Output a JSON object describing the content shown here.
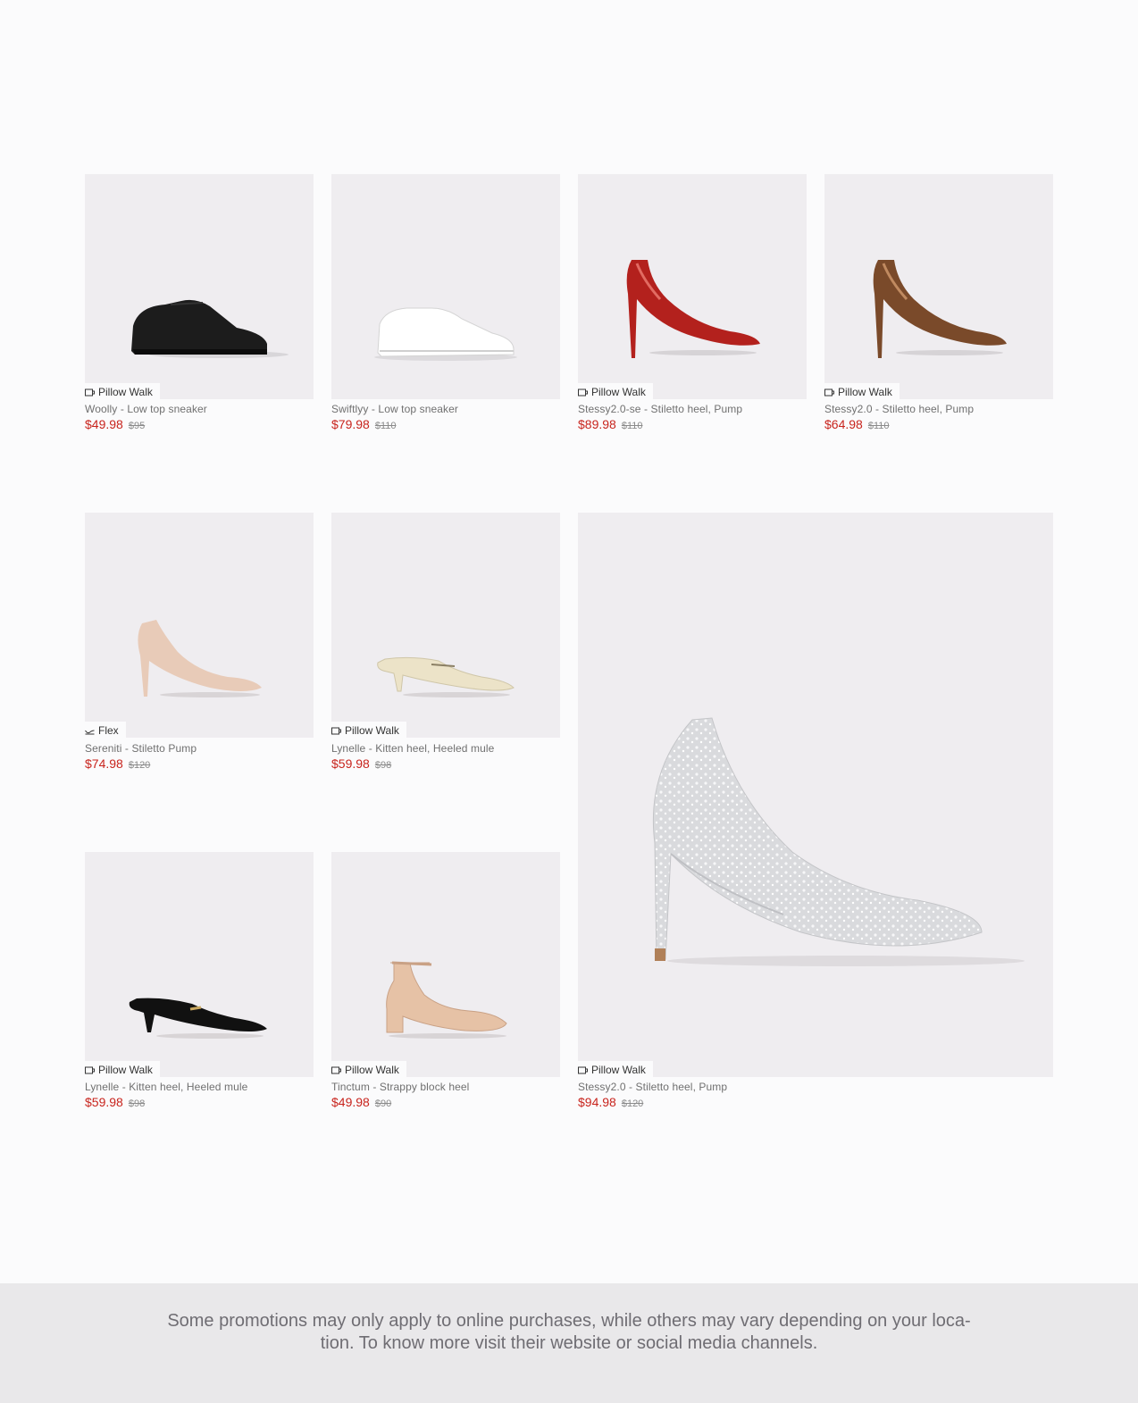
{
  "products": [
    {
      "badge": "Pillow Walk",
      "badge_icon": "cushion-icon",
      "name": "Woolly - Low top sneaker",
      "sale_price": "$49.98",
      "original_price": "$95",
      "shoe": "black-sneaker",
      "color": "#1a1a1a"
    },
    {
      "badge": "",
      "badge_icon": "",
      "name": "Swiftlyy - Low top sneaker",
      "sale_price": "$79.98",
      "original_price": "$110",
      "shoe": "white-sneaker",
      "color": "#ffffff"
    },
    {
      "badge": "Pillow Walk",
      "badge_icon": "cushion-icon",
      "name": "Stessy2.0-se - Stiletto heel, Pump",
      "sale_price": "$89.98",
      "original_price": "$110",
      "shoe": "red-metallic-pump",
      "color": "#b3211d"
    },
    {
      "badge": "Pillow Walk",
      "badge_icon": "cushion-icon",
      "name": "Stessy2.0 - Stiletto heel, Pump",
      "sale_price": "$64.98",
      "original_price": "$110",
      "shoe": "bronze-metallic-pump",
      "color": "#7a4a2a"
    },
    {
      "badge": "Flex",
      "badge_icon": "flex-icon",
      "name": "Sereniti - Stiletto Pump",
      "sale_price": "$74.98",
      "original_price": "$120",
      "shoe": "nude-pump",
      "color": "#e8cbb8"
    },
    {
      "badge": "Pillow Walk",
      "badge_icon": "cushion-icon",
      "name": "Lynelle - Kitten heel, Heeled mule",
      "sale_price": "$59.98",
      "original_price": "$98",
      "shoe": "cream-mule",
      "color": "#ece3c8"
    },
    {
      "badge": "Pillow Walk",
      "badge_icon": "cushion-icon",
      "name": "Lynelle - Kitten heel, Heeled mule",
      "sale_price": "$59.98",
      "original_price": "$98",
      "shoe": "black-mule",
      "color": "#111111"
    },
    {
      "badge": "Pillow Walk",
      "badge_icon": "cushion-icon",
      "name": "Tinctum - Strappy block heel",
      "sale_price": "$49.98",
      "original_price": "$90",
      "shoe": "nude-block-heel",
      "color": "#e6c2a6"
    },
    {
      "badge": "Pillow Walk",
      "badge_icon": "cushion-icon",
      "name": "Stessy2.0 - Stiletto heel, Pump",
      "sale_price": "$94.98",
      "original_price": "$120",
      "shoe": "silver-rhinestone-pump",
      "color": "#d9dadd"
    }
  ],
  "footer": {
    "disclaimer": "Some promotions may only apply to online purchases, while others may vary depending on your loca- tion. To know more visit their website or social media channels."
  }
}
